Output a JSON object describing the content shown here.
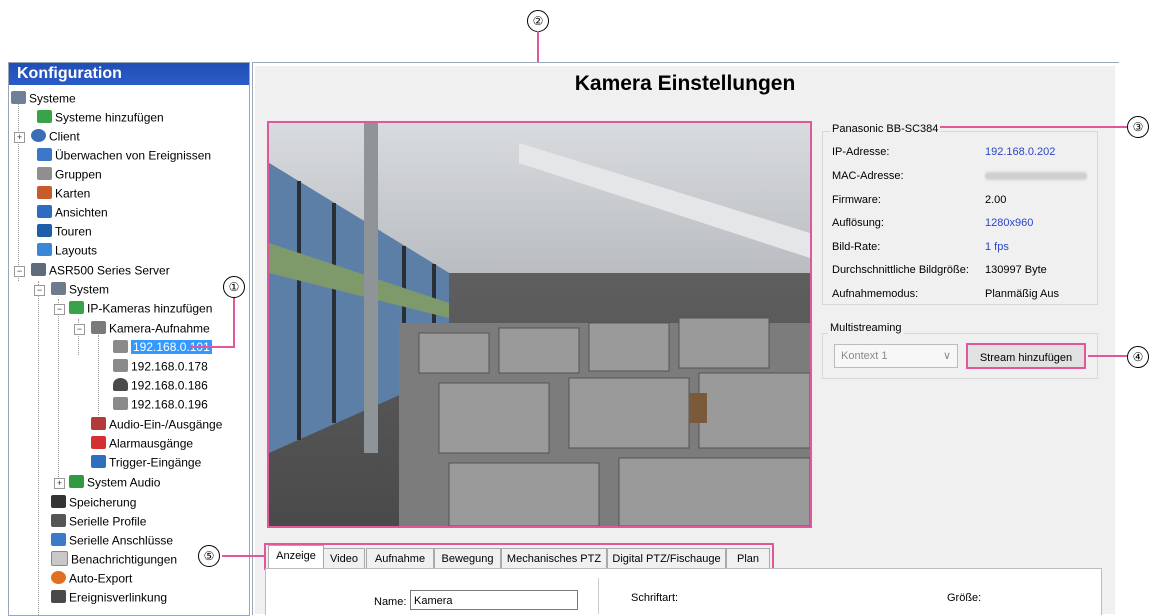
{
  "callouts": [
    "②",
    "①",
    "③",
    "④",
    "⑤"
  ],
  "sidebar": {
    "title": "Konfiguration",
    "items": [
      {
        "label": "Systeme"
      },
      {
        "label": "Systeme hinzufügen"
      },
      {
        "label": "Client"
      },
      {
        "label": "Überwachen von Ereignissen"
      },
      {
        "label": "Gruppen"
      },
      {
        "label": "Karten"
      },
      {
        "label": "Ansichten"
      },
      {
        "label": "Touren"
      },
      {
        "label": "Layouts"
      },
      {
        "label": "ASR500 Series Server"
      },
      {
        "label": "System"
      },
      {
        "label": "IP-Kameras hinzufügen"
      },
      {
        "label": "Kamera-Aufnahme"
      },
      {
        "label": "192.168.0.101"
      },
      {
        "label": "192.168.0.178"
      },
      {
        "label": "192.168.0.186"
      },
      {
        "label": "192.168.0.196"
      },
      {
        "label": "Audio-Ein-/Ausgänge"
      },
      {
        "label": "Alarmausgänge"
      },
      {
        "label": "Trigger-Eingänge"
      },
      {
        "label": "System Audio"
      },
      {
        "label": "Speicherung"
      },
      {
        "label": "Serielle Profile"
      },
      {
        "label": "Serielle Anschlüsse"
      },
      {
        "label": "Benachrichtigungen"
      },
      {
        "label": "Auto-Export"
      },
      {
        "label": "Ereignisverlinkung"
      }
    ]
  },
  "main": {
    "title": "Kamera Einstellungen",
    "camera": {
      "model": "Panasonic BB-SC384",
      "rows": [
        {
          "label": "IP-Adresse:",
          "value": "192.168.0.202"
        },
        {
          "label": "MAC-Adresse:",
          "value": ""
        },
        {
          "label": "Firmware:",
          "value": "2.00"
        },
        {
          "label": "Auflösung:",
          "value": "1280x960"
        },
        {
          "label": "Bild-Rate:",
          "value": "1 fps"
        },
        {
          "label": "Durchschnittliche Bildgröße:",
          "value": "130997 Byte"
        },
        {
          "label": "Aufnahmemodus:",
          "value": "Planmäßig Aus"
        }
      ]
    },
    "multistreaming": {
      "label": "Multistreaming",
      "select_value": "Kontext 1",
      "add_button": "Stream hinzufügen"
    },
    "tabs": [
      {
        "label": "Anzeige"
      },
      {
        "label": "Video"
      },
      {
        "label": "Aufnahme"
      },
      {
        "label": "Bewegung"
      },
      {
        "label": "Mechanisches PTZ"
      },
      {
        "label": "Digital PTZ/Fischauge"
      },
      {
        "label": "Plan"
      }
    ],
    "display": {
      "name_label": "Name:",
      "name_value": "Kamera",
      "font_label": "Schriftart:",
      "size_label": "Größe:"
    }
  },
  "colors": {
    "accent": "#e0579b",
    "header": "#2a5cc8",
    "link": "#2b45c7",
    "selection": "#3399ff"
  }
}
